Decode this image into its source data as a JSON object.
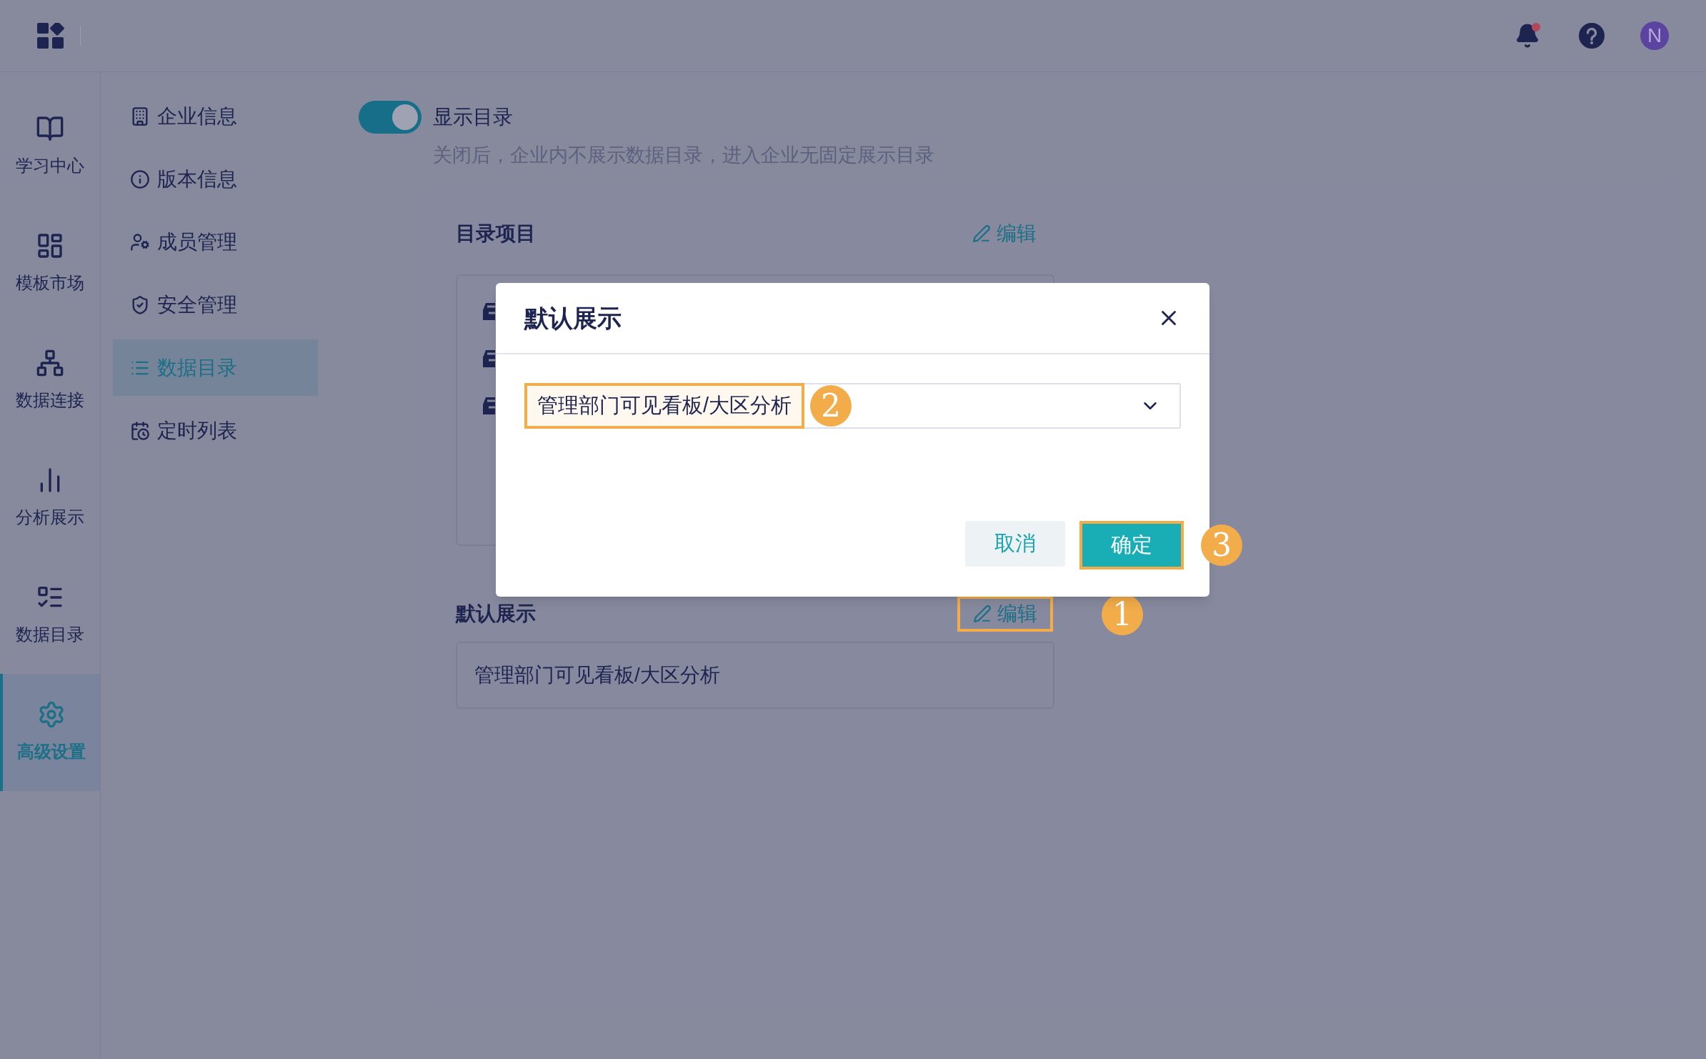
{
  "topbar": {
    "avatar": "N",
    "notification_dot": true
  },
  "rail": [
    {
      "label": "学习中心",
      "selected": false
    },
    {
      "label": "模板市场",
      "selected": false
    },
    {
      "label": "数据连接",
      "selected": false
    },
    {
      "label": "分析展示",
      "selected": false
    },
    {
      "label": "数据目录",
      "selected": false
    },
    {
      "label": "高级设置",
      "selected": true
    }
  ],
  "menu": [
    {
      "label": "企业信息",
      "selected": false
    },
    {
      "label": "版本信息",
      "selected": false
    },
    {
      "label": "成员管理",
      "selected": false
    },
    {
      "label": "安全管理",
      "selected": false
    },
    {
      "label": "数据目录",
      "selected": true
    },
    {
      "label": "定时列表",
      "selected": false
    }
  ],
  "toggle": {
    "label": "显示目录",
    "on": true,
    "description": "关闭后，企业内不展示数据目录，进入企业无固定展示目录"
  },
  "catalog": {
    "title": "目录项目",
    "edit": "编辑"
  },
  "default_display": {
    "title": "默认展示",
    "edit": "编辑",
    "value": "管理部门可见看板/大区分析",
    "badge": "1"
  },
  "dialog": {
    "title": "默认展示",
    "select_value": "管理部门可见看板/大区分析",
    "select_badge": "2",
    "cancel": "取消",
    "confirm": "确定",
    "confirm_badge": "3"
  }
}
